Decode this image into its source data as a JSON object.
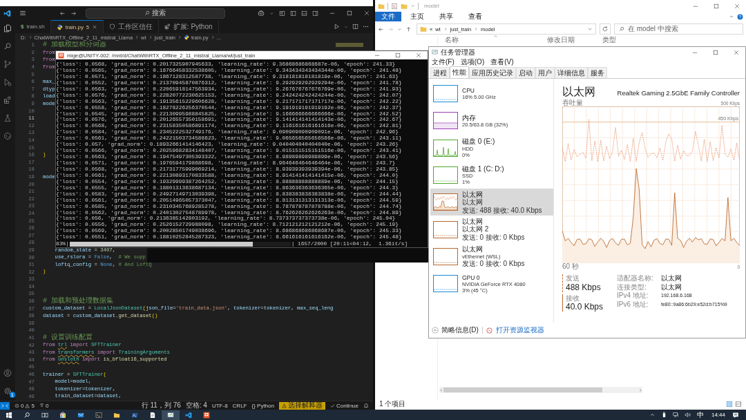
{
  "vscode": {
    "search": {
      "placeholder": "搜索"
    },
    "tabs": [
      {
        "label": "train.sh",
        "kind": "shell",
        "glyph": "$",
        "selected": false
      },
      {
        "label": "train.py",
        "kind": "python",
        "problems": "5",
        "selected": true
      },
      {
        "label": "工作区信任",
        "kind": "shield",
        "selected": false
      },
      {
        "label": "扩展: Python",
        "kind": "extension",
        "selected": false
      }
    ],
    "breadcrumb": [
      "D:",
      "ChatWithRTX_Offline_2_11_mistral_Llama",
      "wt",
      "just_train",
      "train.py",
      "..."
    ],
    "settings_badge": "1",
    "lines": [
      {
        "number": "1",
        "selected": false,
        "segments": [
          {
            "text": "# 加载模型和分词器",
            "kind": "comment"
          }
        ]
      },
      {
        "number": "2",
        "selected": false,
        "segments": [
          {
            "text": "from",
            "kind": "keyword"
          }
        ]
      },
      {
        "number": "3",
        "selected": false,
        "segments": [
          {
            "text": "from",
            "kind": "keyword"
          }
        ]
      },
      {
        "number": "4",
        "selected": false,
        "segments": [
          {
            "text": "from",
            "kind": "keyword"
          }
        ]
      },
      {
        "number": "5",
        "selected": false
      },
      {
        "number": "6",
        "selected": false,
        "segments": [
          {
            "text": "max_",
            "kind": "variable"
          }
        ]
      },
      {
        "number": "7",
        "selected": false,
        "segments": [
          {
            "text": "dtyp",
            "kind": "variable"
          }
        ]
      },
      {
        "number": "8",
        "selected": false,
        "segments": [
          {
            "text": "load",
            "kind": "variable"
          }
        ]
      },
      {
        "number": "9",
        "selected": false,
        "segments": [
          {
            "text": "mode",
            "kind": "variable"
          }
        ]
      },
      {
        "number": "10",
        "selected": false
      },
      {
        "number": "11",
        "selected": true
      },
      {
        "number": "12",
        "selected": false
      },
      {
        "number": "13",
        "selected": false
      },
      {
        "number": "14",
        "selected": false
      },
      {
        "number": "15",
        "selected": false
      },
      {
        "number": "16",
        "selected": false,
        "segments": [
          {
            "text": ")",
            "kind": "bracket"
          }
        ]
      },
      {
        "number": "17",
        "selected": false
      },
      {
        "number": "18",
        "selected": false
      },
      {
        "number": "19",
        "selected": false,
        "segments": [
          {
            "text": "mode",
            "kind": "variable"
          }
        ]
      },
      {
        "number": "20",
        "selected": false
      },
      {
        "number": "21",
        "selected": false
      },
      {
        "number": "22",
        "selected": false
      },
      {
        "number": "23",
        "selected": false
      },
      {
        "number": "24",
        "selected": false
      },
      {
        "number": "25",
        "selected": false
      },
      {
        "number": "26",
        "selected": false
      },
      {
        "number": "27",
        "selected": false
      },
      {
        "number": "28",
        "selected": false
      },
      {
        "number": "29",
        "selected": false,
        "indented": true,
        "segments": [
          {
            "text": "random_state",
            "kind": "param"
          },
          {
            "text": " = ",
            "kind": "plain"
          },
          {
            "text": "3407",
            "kind": "number"
          },
          {
            "text": ",",
            "kind": "plain"
          }
        ]
      },
      {
        "number": "30",
        "selected": false,
        "indented": true,
        "segments": [
          {
            "text": "use_rslora",
            "kind": "param"
          },
          {
            "text": " = ",
            "kind": "plain"
          },
          {
            "text": "False",
            "kind": "constant"
          },
          {
            "text": ",  ",
            "kind": "plain"
          },
          {
            "text": "# We supp",
            "kind": "comment"
          }
        ]
      },
      {
        "number": "31",
        "selected": false,
        "indented": true,
        "segments": [
          {
            "text": "loftq_config",
            "kind": "param"
          },
          {
            "text": " = ",
            "kind": "plain"
          },
          {
            "text": "None",
            "kind": "constant"
          },
          {
            "text": ", ",
            "kind": "plain"
          },
          {
            "text": "# And LoftQ",
            "kind": "comment"
          }
        ]
      },
      {
        "number": "32",
        "selected": false,
        "segments": [
          {
            "text": ")",
            "kind": "bracket"
          }
        ]
      },
      {
        "number": "33",
        "selected": false
      },
      {
        "number": "34",
        "selected": false
      },
      {
        "number": "35",
        "selected": false
      },
      {
        "number": "36",
        "selected": false,
        "segments": [
          {
            "text": "# 加载和预处理数据集",
            "kind": "comment"
          }
        ]
      },
      {
        "number": "37",
        "selected": false,
        "segments": [
          {
            "text": "custom_dataset",
            "kind": "variable"
          },
          {
            "text": " = ",
            "kind": "plain"
          },
          {
            "text": "LocalJsonDataset",
            "kind": "class"
          },
          {
            "text": "(",
            "kind": "bracket"
          },
          {
            "text": "json_file",
            "kind": "param"
          },
          {
            "text": "=",
            "kind": "plain"
          },
          {
            "text": "'train_data.json'",
            "kind": "string"
          },
          {
            "text": ", ",
            "kind": "plain"
          },
          {
            "text": "tokenizer",
            "kind": "param"
          },
          {
            "text": "=",
            "kind": "plain"
          },
          {
            "text": "tokenizer",
            "kind": "variable"
          },
          {
            "text": ", ",
            "kind": "plain"
          },
          {
            "text": "max_seq_leng",
            "kind": "param"
          }
        ]
      },
      {
        "number": "38",
        "selected": false,
        "segments": [
          {
            "text": "dataset",
            "kind": "variable"
          },
          {
            "text": " = ",
            "kind": "plain"
          },
          {
            "text": "custom_dataset",
            "kind": "variable"
          },
          {
            "text": ".",
            "kind": "plain"
          },
          {
            "text": "get_dataset",
            "kind": "function"
          },
          {
            "text": "()",
            "kind": "bracket"
          }
        ]
      },
      {
        "number": "39",
        "selected": false
      },
      {
        "number": "40",
        "selected": false
      },
      {
        "number": "41",
        "selected": false,
        "segments": [
          {
            "text": "# 设置训练配置",
            "kind": "comment"
          }
        ]
      },
      {
        "number": "42",
        "selected": false,
        "segments": [
          {
            "text": "from ",
            "kind": "keyword"
          },
          {
            "text": "trl",
            "kind": "module"
          },
          {
            "text": " import ",
            "kind": "keyword"
          },
          {
            "text": "SFTTrainer",
            "kind": "class"
          }
        ]
      },
      {
        "number": "43",
        "selected": false,
        "segments": [
          {
            "text": "from ",
            "kind": "keyword"
          },
          {
            "text": "transformers",
            "kind": "module"
          },
          {
            "text": " import ",
            "kind": "keyword"
          },
          {
            "text": "TrainingArguments",
            "kind": "class"
          }
        ]
      },
      {
        "number": "44",
        "selected": false,
        "segments": [
          {
            "text": "from ",
            "kind": "keyword"
          },
          {
            "text": "unsloth",
            "kind": "module"
          },
          {
            "text": " import ",
            "kind": "keyword"
          },
          {
            "text": "is_bfloat16_supported",
            "kind": "function"
          }
        ]
      },
      {
        "number": "45",
        "selected": false
      },
      {
        "number": "46",
        "selected": false,
        "segments": [
          {
            "text": "trainer",
            "kind": "variable"
          },
          {
            "text": " = ",
            "kind": "plain"
          },
          {
            "text": "SFTTrainer",
            "kind": "class"
          },
          {
            "text": "(",
            "kind": "bracket"
          }
        ]
      },
      {
        "number": "47",
        "selected": false,
        "indented": true,
        "segments": [
          {
            "text": "model",
            "kind": "param"
          },
          {
            "text": "=",
            "kind": "plain"
          },
          {
            "text": "model",
            "kind": "variable"
          },
          {
            "text": ",",
            "kind": "plain"
          }
        ]
      },
      {
        "number": "48",
        "selected": false,
        "indented": true,
        "segments": [
          {
            "text": "tokenizer",
            "kind": "param"
          },
          {
            "text": "=",
            "kind": "plain"
          },
          {
            "text": "tokenizer",
            "kind": "variable"
          },
          {
            "text": ",",
            "kind": "plain"
          }
        ]
      },
      {
        "number": "49",
        "selected": false,
        "indented": true,
        "segments": [
          {
            "text": "train_dataset",
            "kind": "param"
          },
          {
            "text": "=",
            "kind": "plain"
          },
          {
            "text": "dataset",
            "kind": "variable"
          },
          {
            "text": ",",
            "kind": "plain"
          }
        ]
      }
    ],
    "status_bar": {
      "errors": "0",
      "warnings": "5",
      "ports": "0",
      "position": "行 11，列 76",
      "indent": "空格: 4",
      "encoding": "UTF-8",
      "eol": "CRLF",
      "language": "{} Python",
      "interpreter": "选择解释器",
      "assistant": "Continue"
    }
  },
  "file_explorer": {
    "title": "model",
    "ribbon_tabs": [
      {
        "label": "文件",
        "selected": true
      },
      {
        "label": "主页",
        "selected": false
      },
      {
        "label": "共享",
        "selected": false
      },
      {
        "label": "查看",
        "selected": false
      }
    ],
    "address_overflow": "«",
    "address": [
      "wt",
      "just_train",
      "model"
    ],
    "search": {
      "placeholder": "在 model 中搜索"
    },
    "columns": [
      "名称",
      "修改日期",
      "类型"
    ],
    "status": "1 个项目"
  },
  "terminal": {
    "title": "mige@UNITY-002: /mnt/d/ChatWithRTX_Offline_2_11_mistral_Llama/wt/just_train",
    "lines": [
      "{'loss': 0.0568, 'grad_norm': 0.2017325907945633, 'learning_rate': 9.36868686868687e-06, 'epoch': 241.33}",
      "{'loss': 0.0565, 'grad_norm': 0.18766458332538605, 'learning_rate': 9.343434343434344e-06, 'epoch': 241.48}",
      "{'loss': 0.0571, 'grad_norm': 0.1867128312587738, 'learning_rate': 9.318181818181819e-06, 'epoch': 241.63}",
      "{'loss': 0.0552, 'grad_norm': 0.21370945870876312, 'learning_rate': 9.292929292929294e-06, 'epoch': 241.78}",
      "{'loss': 0.0563, 'grad_norm': 0.22065918147563934, 'learning_rate': 9.267676767676769e-06, 'epoch': 241.93}",
      "{'loss': 0.0576, 'grad_norm': 0.22820772230625153, 'learning_rate': 9.242424242424244e-06, 'epoch': 242.07}",
      "{'loss': 0.0563, 'grad_norm': 0.19135615229606628, 'learning_rate': 9.217171717171717e-06, 'epoch': 242.22}",
      "{'loss': 0.0558, 'grad_norm': 0.18278226256370544, 'learning_rate': 9.191919191919192e-06, 'epoch': 242.37}",
      "{'loss': 0.0545, 'grad_norm': 0.22130995988845825, 'learning_rate': 9.166666666666666e-06, 'epoch': 242.52}",
      "{'loss': 0.0576, 'grad_norm': 0.20126557350158691, 'learning_rate': 9.141414141414143e-06, 'epoch': 242.67}",
      "{'loss': 0.0568, 'grad_norm': 0.23158350586891174, 'learning_rate': 9.116161616161616e-06, 'epoch': 242.81}",
      "{'loss': 0.0584, 'grad_norm': 0.2345222532749176, 'learning_rate': 9.090909090909091e-06, 'epoch': 242.96}",
      "{'loss': 0.0561, 'grad_norm': 0.24221503734588623, 'learning_rate': 9.065656565656566e-06, 'epoch': 243.11}",
      "{'loss': 0.057, 'grad_norm': 0.18932661414146423, 'learning_rate': 9.040404040404040e-06, 'epoch': 243.26}",
      "{'loss': 0.0566, 'grad_norm': 0.20259682834148407, 'learning_rate': 9.015151515151516e-06, 'epoch': 243.41}",
      "{'loss': 0.0563, 'grad_norm': 0.19475497305393322, 'learning_rate': 8.98989898989899e-06, 'epoch': 243.56}",
      "{'loss': 0.0571, 'grad_norm': 0.1976594179868698, 'learning_rate': 8.964646464646464e-06, 'epoch': 243.7}",
      "{'loss': 0.0568, 'grad_norm': 0.21731775999069214, 'learning_rate': 8.93939393939394e-06, 'epoch': 243.85}",
      "{'loss': 0.0561, 'grad_norm': 0.22130893170833588, 'learning_rate': 8.914141414141415e-06, 'epoch': 244.0}",
      "{'loss': 0.0554, 'grad_norm': 0.19329999387264252, 'learning_rate': 8.88888888888889e-06, 'epoch': 244.15}",
      "{'loss': 0.0555, 'grad_norm': 0.18801313638687134, 'learning_rate': 8.863636363636365e-06, 'epoch': 244.3}",
      "{'loss': 0.0583, 'grad_norm': 0.24927149713039398, 'learning_rate': 8.838383838383838e-06, 'epoch': 244.44}",
      "{'loss': 0.0561, 'grad_norm': 0.20514965057373047, 'learning_rate': 8.813131313131313e-06, 'epoch': 244.59}",
      "{'loss': 0.0585, 'grad_norm': 0.23103457689285278, 'learning_rate': 8.787878787878788e-06, 'epoch': 244.74}",
      "{'loss': 0.0562, 'grad_norm': 0.24013027548789978, 'learning_rate': 8.762626262626263e-06, 'epoch': 244.89}",
      "{'loss': 0.056, 'grad_norm': 0.2136385142803192, 'learning_rate': 8.737373737373738e-06, 'epoch': 245.04}",
      "{'loss': 0.0556, 'grad_norm': 0.2526152729988098, 'learning_rate': 8.712121212121212e-06, 'epoch': 245.19}",
      "{'loss': 0.0569, 'grad_norm': 0.20028501749038696, 'learning_rate': 8.686868686868687e-06, 'epoch': 245.33}",
      "{'loss': 0.0551, 'grad_norm': 0.18810252845287323, 'learning_rate': 8.661616161616162e-06, 'epoch': 245.48}"
    ],
    "progress": {
      "percent": "83%|",
      "level": 0.83,
      "stats": "| 1657/2000 [20:11<04:12,  1.36it/s]"
    }
  },
  "task_manager": {
    "title": "任务管理器",
    "menu": [
      "文件(F)",
      "选项(O)",
      "查看(V)"
    ],
    "tabs": [
      {
        "label": "进程",
        "selected": false
      },
      {
        "label": "性能",
        "selected": true
      },
      {
        "label": "应用历史记录",
        "selected": false
      },
      {
        "label": "启动",
        "selected": false
      },
      {
        "label": "用户",
        "selected": false
      },
      {
        "label": "详细信息",
        "selected": false
      },
      {
        "label": "服务",
        "selected": false
      }
    ],
    "items": [
      {
        "title": "CPU",
        "lines": [
          "16% 5.00 GHz"
        ],
        "color": "#1a8bd1",
        "selected": false
      },
      {
        "title": "内存",
        "lines": [
          "20.5/63.8 GB (32%)"
        ],
        "color": "#9b3fb5",
        "selected": false
      },
      {
        "title": "磁盘 0 (E:)",
        "lines": [
          "HDD",
          "0%"
        ],
        "color": "#4da82b",
        "selected": false
      },
      {
        "title": "磁盘 1 (C: D:)",
        "lines": [
          "SSD",
          "1%"
        ],
        "color": "#4da82b",
        "selected": false
      },
      {
        "title": "以太网",
        "lines": [
          "以太网",
          "发送: 488 接收: 40.0 Kbps"
        ],
        "color": "#b8682e",
        "selected": true
      },
      {
        "title": "以太网",
        "lines": [
          "以太网 2",
          "发送: 0 接收: 0 Kbps"
        ],
        "color": "#b8682e",
        "selected": false
      },
      {
        "title": "以太网",
        "lines": [
          "vEthernet (WSL)",
          "发送: 0 接收: 0 Kbps"
        ],
        "color": "#b8682e",
        "selected": false
      },
      {
        "title": "GPU 0",
        "lines": [
          "NVIDIA GeForce RTX 4080",
          "3% (45 °C)"
        ],
        "color": "#1a8bd1",
        "selected": false
      }
    ],
    "detail": {
      "title": "以太网",
      "device": "Realtek Gaming 2.5GbE Family Controller",
      "graph_label": "吞吐量",
      "graph_max": "500 Kbps",
      "graph_mark": "450 Kbps",
      "time_span": "60 秒",
      "time_end": "0",
      "send": {
        "label": "发送",
        "value": "488 Kbps"
      },
      "receive": {
        "label": "接收",
        "value": "40.0 Kbps"
      },
      "properties": [
        {
          "label": "适配器名称:",
          "value": "以太网"
        },
        {
          "label": "连接类型:",
          "value": "以太网"
        },
        {
          "label": "IPv4 地址:",
          "value": "192.168.6.168"
        },
        {
          "label": "IPv6 地址:",
          "value": "fe80::9a86:6b29:e52d:b715%9"
        }
      ]
    },
    "fewer_details": "简略信息(D)",
    "monitor_link": "打开资源监视器"
  },
  "taskbar": {
    "apps": [
      {
        "kind": "start",
        "selected": false
      },
      {
        "kind": "search",
        "selected": false
      },
      {
        "kind": "task-view",
        "selected": false
      },
      {
        "kind": "store",
        "selected": false
      },
      {
        "kind": "mail",
        "selected": false
      },
      {
        "kind": "terminal",
        "selected": false
      },
      {
        "kind": "folder",
        "selected": false
      },
      {
        "kind": "powershell",
        "selected": false
      },
      {
        "kind": "notepad",
        "selected": false
      },
      {
        "kind": "monitor",
        "selected": true
      },
      {
        "kind": "vscode",
        "selected": false
      },
      {
        "kind": "ubuntu",
        "selected": false
      }
    ],
    "ime": "中",
    "clock": "14:44"
  }
}
